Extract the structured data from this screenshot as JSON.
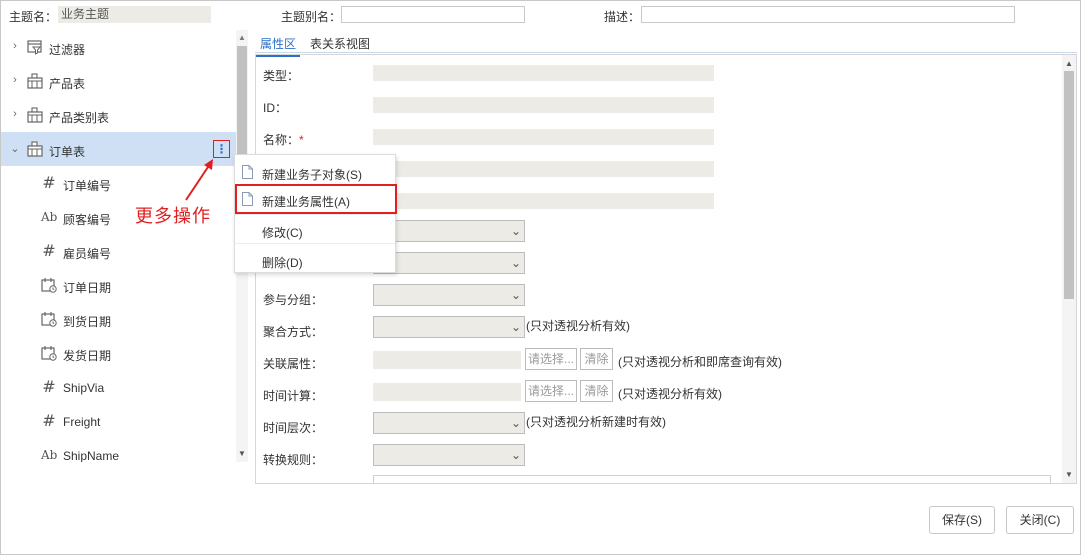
{
  "topbar": {
    "topic_name_label": "主题名：",
    "topic_name_value": "业务主题",
    "alias_label": "主题别名：",
    "alias_value": "",
    "desc_label": "描述：",
    "desc_value": ""
  },
  "tree": {
    "items": [
      {
        "label": "过滤器",
        "icon": "filter-table-icon",
        "expanded": false
      },
      {
        "label": "产品表",
        "icon": "table-icon",
        "expanded": false
      },
      {
        "label": "产品类别表",
        "icon": "table-icon",
        "expanded": false
      },
      {
        "label": "订单表",
        "icon": "table-icon",
        "expanded": true,
        "selected": true
      }
    ],
    "children": [
      {
        "label": "订单编号",
        "icon": "hash-icon",
        "glyph": "#"
      },
      {
        "label": "顾客编号",
        "icon": "text-field-icon",
        "glyph": "Ab"
      },
      {
        "label": "雇员编号",
        "icon": "hash-icon",
        "glyph": "#"
      },
      {
        "label": "订单日期",
        "icon": "calendar-icon",
        "glyph": ""
      },
      {
        "label": "到货日期",
        "icon": "calendar-icon",
        "glyph": ""
      },
      {
        "label": "发货日期",
        "icon": "calendar-icon",
        "glyph": ""
      },
      {
        "label": "ShipVia",
        "icon": "hash-icon",
        "glyph": "#"
      },
      {
        "label": "Freight",
        "icon": "hash-icon",
        "glyph": "#"
      },
      {
        "label": "ShipName",
        "icon": "text-field-icon",
        "glyph": "Ab"
      }
    ],
    "more_glyph": "⋮"
  },
  "annotation": "更多操作",
  "tabs": [
    {
      "label": "属性区",
      "active": true
    },
    {
      "label": "表关系视图",
      "active": false
    }
  ],
  "properties": {
    "type_label": "类型：",
    "id_label": "ID：",
    "name_label": "名称：",
    "name_required": "*",
    "group_label": "参与分组：",
    "agg_label": "聚合方式：",
    "agg_note": "(只对透视分析有效)",
    "rel_label": "关联属性：",
    "rel_note": "(只对透视分析和即席查询有效)",
    "time_calc_label": "时间计算：",
    "time_calc_note": "(只对透视分析有效)",
    "time_level_label": "时间层次：",
    "time_level_note": "(只对透视分析新建时有效)",
    "convert_label": "转换规则：",
    "select_button": "请选择...",
    "clear_button": "清除"
  },
  "context_menu": {
    "items": [
      {
        "label": "新建业务子对象(S)",
        "icon": "document-icon"
      },
      {
        "label": "新建业务属性(A)",
        "icon": "document-icon",
        "highlighted": true
      },
      {
        "label": "修改(C)",
        "icon": ""
      },
      {
        "label": "删除(D)",
        "icon": ""
      }
    ]
  },
  "footer": {
    "save_label": "保存(S)",
    "close_label": "关闭(C)"
  },
  "colors": {
    "accent": "#2b6fc8",
    "highlight": "#e02020",
    "selected_row": "#cfe0f5",
    "readonly_field": "#ecebe6"
  }
}
